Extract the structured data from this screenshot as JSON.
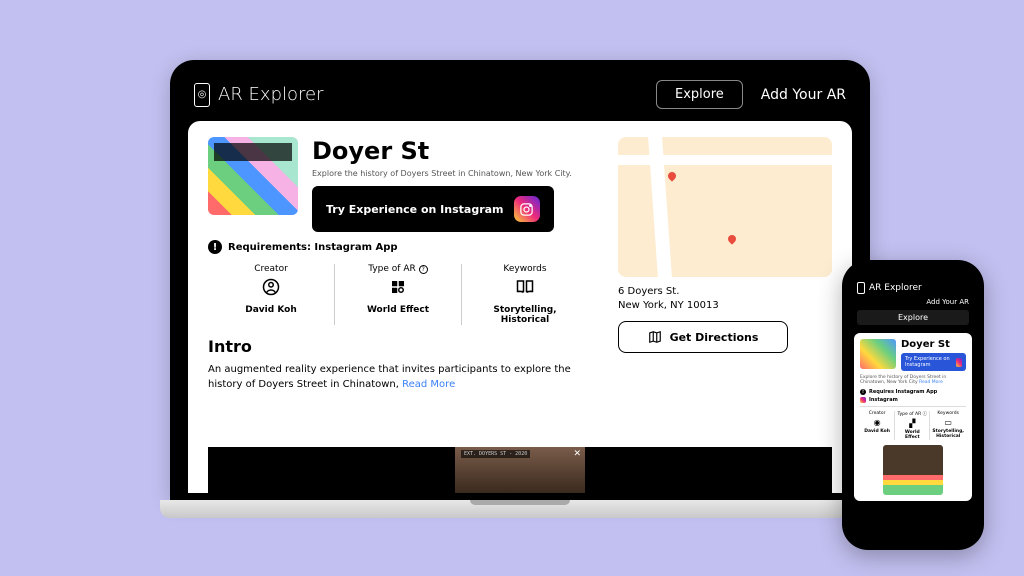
{
  "brand": "AR Explorer",
  "nav": {
    "explore": "Explore",
    "add": "Add Your AR"
  },
  "page": {
    "title": "Doyer St",
    "tagline": "Explore the history of Doyers Street in Chinatown, New York City.",
    "cta": "Try Experience on Instagram",
    "requirements": "Requirements: Instagram App",
    "meta": {
      "creator": {
        "label": "Creator",
        "value": "David Koh"
      },
      "type": {
        "label": "Type of AR",
        "value": "World Effect"
      },
      "keywords": {
        "label": "Keywords",
        "value": "Storytelling, Historical"
      }
    },
    "intro": {
      "heading": "Intro",
      "body": "An augmented reality experience that invites participants to explore the history of Doyers Street in Chinatown, ",
      "more": "Read More"
    },
    "video_label": "EXT. DOYERS ST - 2020",
    "address": {
      "line1": "6 Doyers St.",
      "line2": "New York, NY 10013"
    },
    "directions": "Get Directions"
  },
  "mobile": {
    "sub": "Explore the history of Doyers Street in Chinatown, New York City ",
    "req2": "Requires Instagram App",
    "ig": "Instagram"
  }
}
